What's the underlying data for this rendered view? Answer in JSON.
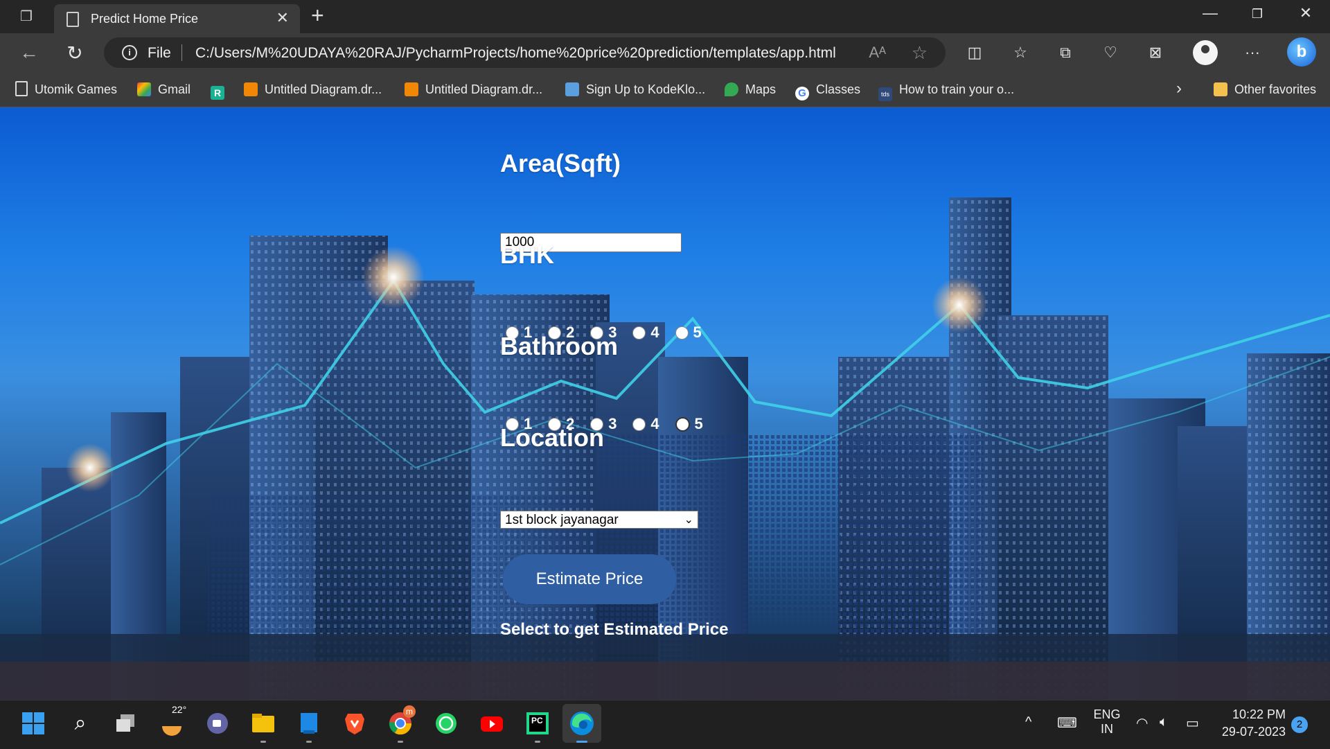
{
  "browser": {
    "tab_title": "Predict Home Price",
    "scheme": "File",
    "url": "C:/Users/M%20UDAYA%20RAJ/PycharmProjects/home%20price%20prediction/templates/app.html",
    "read_aloud": "Á⁾",
    "favorites": [
      {
        "label": "Utomik Games",
        "color": "#dcdcdc"
      },
      {
        "label": "Gmail",
        "color": "#ea4335"
      },
      {
        "label": "",
        "color": "#19b394"
      },
      {
        "label": "Untitled Diagram.dr...",
        "color": "#f08705"
      },
      {
        "label": "Untitled Diagram.dr...",
        "color": "#f08705"
      },
      {
        "label": "Sign Up to KodeKlo...",
        "color": "#5aa0e0"
      },
      {
        "label": "Maps",
        "color": "#34a853"
      },
      {
        "label": "Classes",
        "color": "#ffffff"
      },
      {
        "label": "How to train your o...",
        "color": "#2f4a7a"
      }
    ],
    "fav_r_text": "R",
    "fav_tds_text": "tds",
    "other_favorites": "Other favorites"
  },
  "form": {
    "area_label": "Area(Sqft)",
    "area_value": "1000",
    "bhk_label": "BHK",
    "bhk_options": [
      "1",
      "2",
      "3",
      "4",
      "5"
    ],
    "bhk_selected": null,
    "bath_label": "Bathroom",
    "bath_options": [
      "1",
      "2",
      "3",
      "4",
      "5"
    ],
    "bath_selected": "5",
    "location_label": "Location",
    "location_value": "1st block jayanagar",
    "button_label": "Estimate Price",
    "result_text": "Select to get Estimated Price"
  },
  "taskbar": {
    "weather_temp": "22°",
    "lang_top": "ENG",
    "lang_bottom": "IN",
    "time": "10:22 PM",
    "date": "29-07-2023",
    "notification_count": "2",
    "pycharm_text": "PC",
    "chrome_badge": "m"
  },
  "colors": {
    "accent_button": "#2f5fa2",
    "sky_top": "#0b5bd1",
    "chart_line": "#3fd0e8"
  }
}
